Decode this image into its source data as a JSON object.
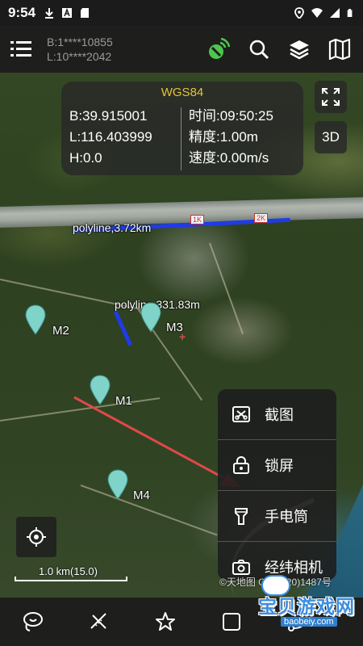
{
  "status_bar": {
    "time": "9:54",
    "icons": [
      "download-icon",
      "font-icon",
      "sd-card-icon"
    ],
    "right_icons": [
      "location-icon",
      "wifi-icon",
      "signal-icon",
      "battery-icon"
    ]
  },
  "top_bar": {
    "coord_b": "B:1****10855",
    "coord_l": "L:10****2042",
    "buttons": [
      "gps-signal-icon",
      "search-icon",
      "layers-icon",
      "map-icon"
    ]
  },
  "info_panel": {
    "crs": "WGS84",
    "b": "B:39.915001",
    "l": "L:116.403999",
    "h": "H:0.0",
    "time": "时间:09:50:25",
    "accuracy": "精度:1.00m",
    "speed": "速度:0.00m/s"
  },
  "side_buttons": {
    "fullscreen_icon": "fullscreen-icon",
    "view_3d": "3D"
  },
  "map_labels": {
    "polyline1": "polyline,3.72km",
    "polyline2": "polyline,331.83m",
    "km1": "1K",
    "km2": "2K",
    "m1": "M1",
    "m2": "M2",
    "m3": "M3",
    "m4": "M4"
  },
  "popup_menu": {
    "items": [
      {
        "label": "截图",
        "icon": "screenshot-icon"
      },
      {
        "label": "锁屏",
        "icon": "lock-icon"
      },
      {
        "label": "手电筒",
        "icon": "flashlight-icon"
      },
      {
        "label": "经纬相机",
        "icon": "camera-icon"
      }
    ]
  },
  "scale_bar": {
    "label": "1.0 km(15.0)"
  },
  "credit": "©天地图 GS(2020)1487号",
  "bottom_bar": {
    "buttons": [
      "lasso-icon",
      "measure-icon",
      "star-icon",
      "tools-icon",
      "route-icon"
    ]
  },
  "watermark": {
    "main": "宝贝游戏网",
    "sub": "baobeiy.com"
  },
  "colors": {
    "crs_accent": "#e6c23b",
    "polyline": "#1f3be8",
    "marker": "#7fd3c9",
    "arrow": "#e04848",
    "gps_active": "#4ec54e"
  }
}
